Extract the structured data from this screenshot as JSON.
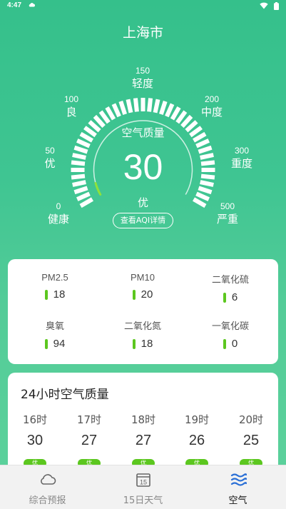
{
  "status_bar": {
    "time": "4:47"
  },
  "city": "上海市",
  "gauge": {
    "title": "空气质量",
    "value": "30",
    "value_fraction": 0.06,
    "level": "优",
    "detail_button": "查看AQI详情",
    "scale": [
      {
        "num": "0",
        "lvl": "健康"
      },
      {
        "num": "50",
        "lvl": "优"
      },
      {
        "num": "100",
        "lvl": "良"
      },
      {
        "num": "150",
        "lvl": "轻度"
      },
      {
        "num": "200",
        "lvl": "中度"
      },
      {
        "num": "300",
        "lvl": "重度"
      },
      {
        "num": "500",
        "lvl": "严重"
      }
    ],
    "indicator_color": "#8fe23a"
  },
  "pollutants": [
    {
      "name": "PM2.5",
      "value": "18"
    },
    {
      "name": "PM10",
      "value": "20"
    },
    {
      "name": "二氧化硫",
      "value": "6"
    },
    {
      "name": "臭氧",
      "value": "94"
    },
    {
      "name": "二氧化氮",
      "value": "18"
    },
    {
      "name": "一氧化碳",
      "value": "0"
    }
  ],
  "hourly": {
    "title": "24小时空气质量",
    "items": [
      {
        "hour": "16时",
        "value": "30",
        "level": "优"
      },
      {
        "hour": "17时",
        "value": "27",
        "level": "优"
      },
      {
        "hour": "18时",
        "value": "27",
        "level": "优"
      },
      {
        "hour": "19时",
        "value": "26",
        "level": "优"
      },
      {
        "hour": "20时",
        "value": "25",
        "level": "优"
      }
    ]
  },
  "nav": {
    "items": [
      {
        "label": "综合预报",
        "icon": "cloud-icon"
      },
      {
        "label": "15日天气",
        "icon": "calendar-15-icon",
        "icon_text": "15"
      },
      {
        "label": "空气",
        "icon": "wind-waves-icon"
      }
    ],
    "active": 2
  },
  "colors": {
    "accent_green": "#3fc592",
    "good_green": "#5cc71f",
    "nav_active_blue": "#2a6fd6"
  }
}
